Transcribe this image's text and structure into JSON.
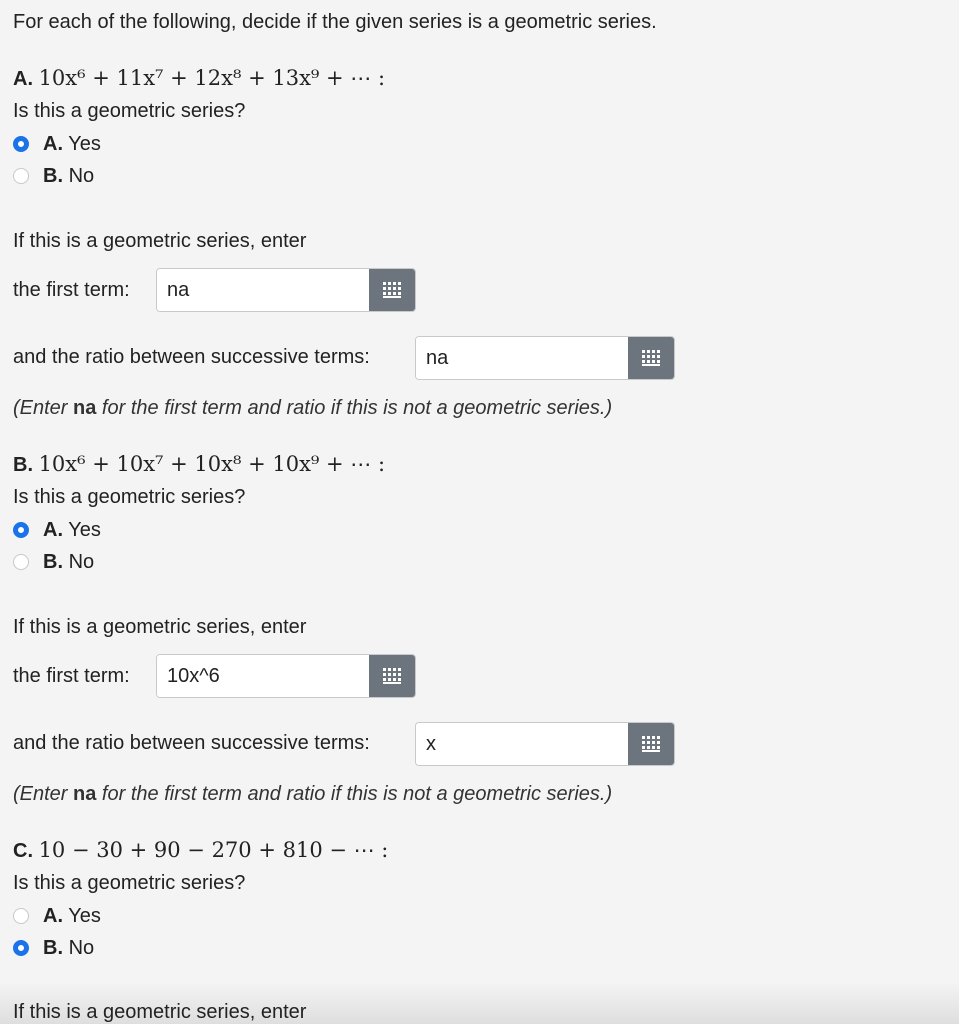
{
  "instructions": "For each of the following, decide if the given series is a geometric series.",
  "problems": [
    {
      "label": "A.",
      "series": "10x⁶ + 11x⁷ + 12x⁸ + 13x⁹ + ⋯ :",
      "question": "Is this a geometric series?",
      "options": [
        {
          "key": "A.",
          "text": "Yes"
        },
        {
          "key": "B.",
          "text": "No"
        }
      ],
      "selected": "A",
      "enter_prompt": "If this is a geometric series, enter",
      "first_term_label": "the first term:",
      "first_term_value": "na",
      "ratio_label": "and the ratio between successive terms:",
      "ratio_value": "na",
      "note_pre": "(Enter ",
      "note_bold": "na",
      "note_post": " for the first term and ratio if this is not a geometric series.)"
    },
    {
      "label": "B.",
      "series": "10x⁶ + 10x⁷ + 10x⁸ + 10x⁹ + ⋯ :",
      "question": "Is this a geometric series?",
      "options": [
        {
          "key": "A.",
          "text": "Yes"
        },
        {
          "key": "B.",
          "text": "No"
        }
      ],
      "selected": "A",
      "enter_prompt": "If this is a geometric series, enter",
      "first_term_label": "the first term:",
      "first_term_value": "10x^6",
      "ratio_label": "and the ratio between successive terms:",
      "ratio_value": "x",
      "note_pre": "(Enter ",
      "note_bold": "na",
      "note_post": " for the first term and ratio if this is not a geometric series.)"
    },
    {
      "label": "C.",
      "series": "10 − 30 + 90 − 270 + 810 − ⋯ :",
      "question": "Is this a geometric series?",
      "options": [
        {
          "key": "A.",
          "text": "Yes"
        },
        {
          "key": "B.",
          "text": "No"
        }
      ],
      "selected": "B",
      "enter_prompt": "If this is a geometric series, enter"
    }
  ],
  "colors": {
    "radio_selected": "#1a73e8",
    "keypad_button": "#6c757d",
    "background": "#f4f4f4"
  },
  "icons": {
    "keypad": "keypad-grid-icon"
  }
}
